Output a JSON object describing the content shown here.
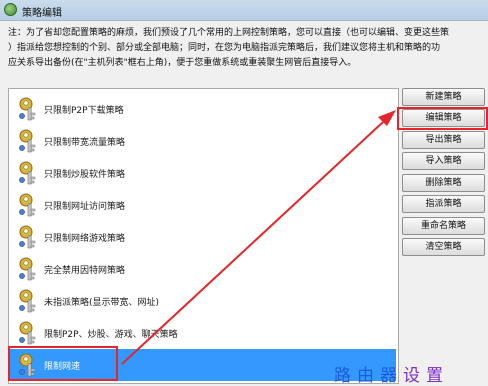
{
  "window": {
    "title": "策略编辑"
  },
  "note": {
    "lines": [
      "注：为了省却您配置策略的麻烦，我们预设了几个常用的上网控制策略，您可以直接（也可以编辑、变更这些策",
      "）指派给您想控制的个别、部分或全部电脑；同时，在您为电脑指派完策略后，我们建议您将主机和策略的功",
      "应关系导出备份(在\"主机列表\"框右上角)，便于您重做系统或重装聚生网管后直接导入。"
    ]
  },
  "policies": [
    {
      "label": "只限制P2P下载策略"
    },
    {
      "label": "只限制带宽流量策略"
    },
    {
      "label": "只限制炒股软件策略"
    },
    {
      "label": "只限制网址访问策略"
    },
    {
      "label": "只限制网络游戏策略"
    },
    {
      "label": "完全禁用因特网策略"
    },
    {
      "label": "未指派策略(显示带宽、网址)"
    },
    {
      "label": "限制P2P、炒股、游戏、聊天策略"
    },
    {
      "label": "限制网速"
    }
  ],
  "selected_policy": "限制网速",
  "buttons": {
    "new": "新建策略",
    "edit": "编辑策略",
    "export": "导出策略",
    "import": "导入策略",
    "delete": "删除策略",
    "assign": "指派策略",
    "rename": "重命名策略",
    "clear": "清空策略"
  },
  "watermark": {
    "part1": "路由器",
    "part2": "设置"
  },
  "colors": {
    "annotation": "#e8232a",
    "selection": "#3399ff",
    "watermark_blue": "#1e5bd6",
    "watermark_purple": "#7a2fc6"
  },
  "icons": {
    "policy_item": "key-icon",
    "window": "app-icon"
  }
}
